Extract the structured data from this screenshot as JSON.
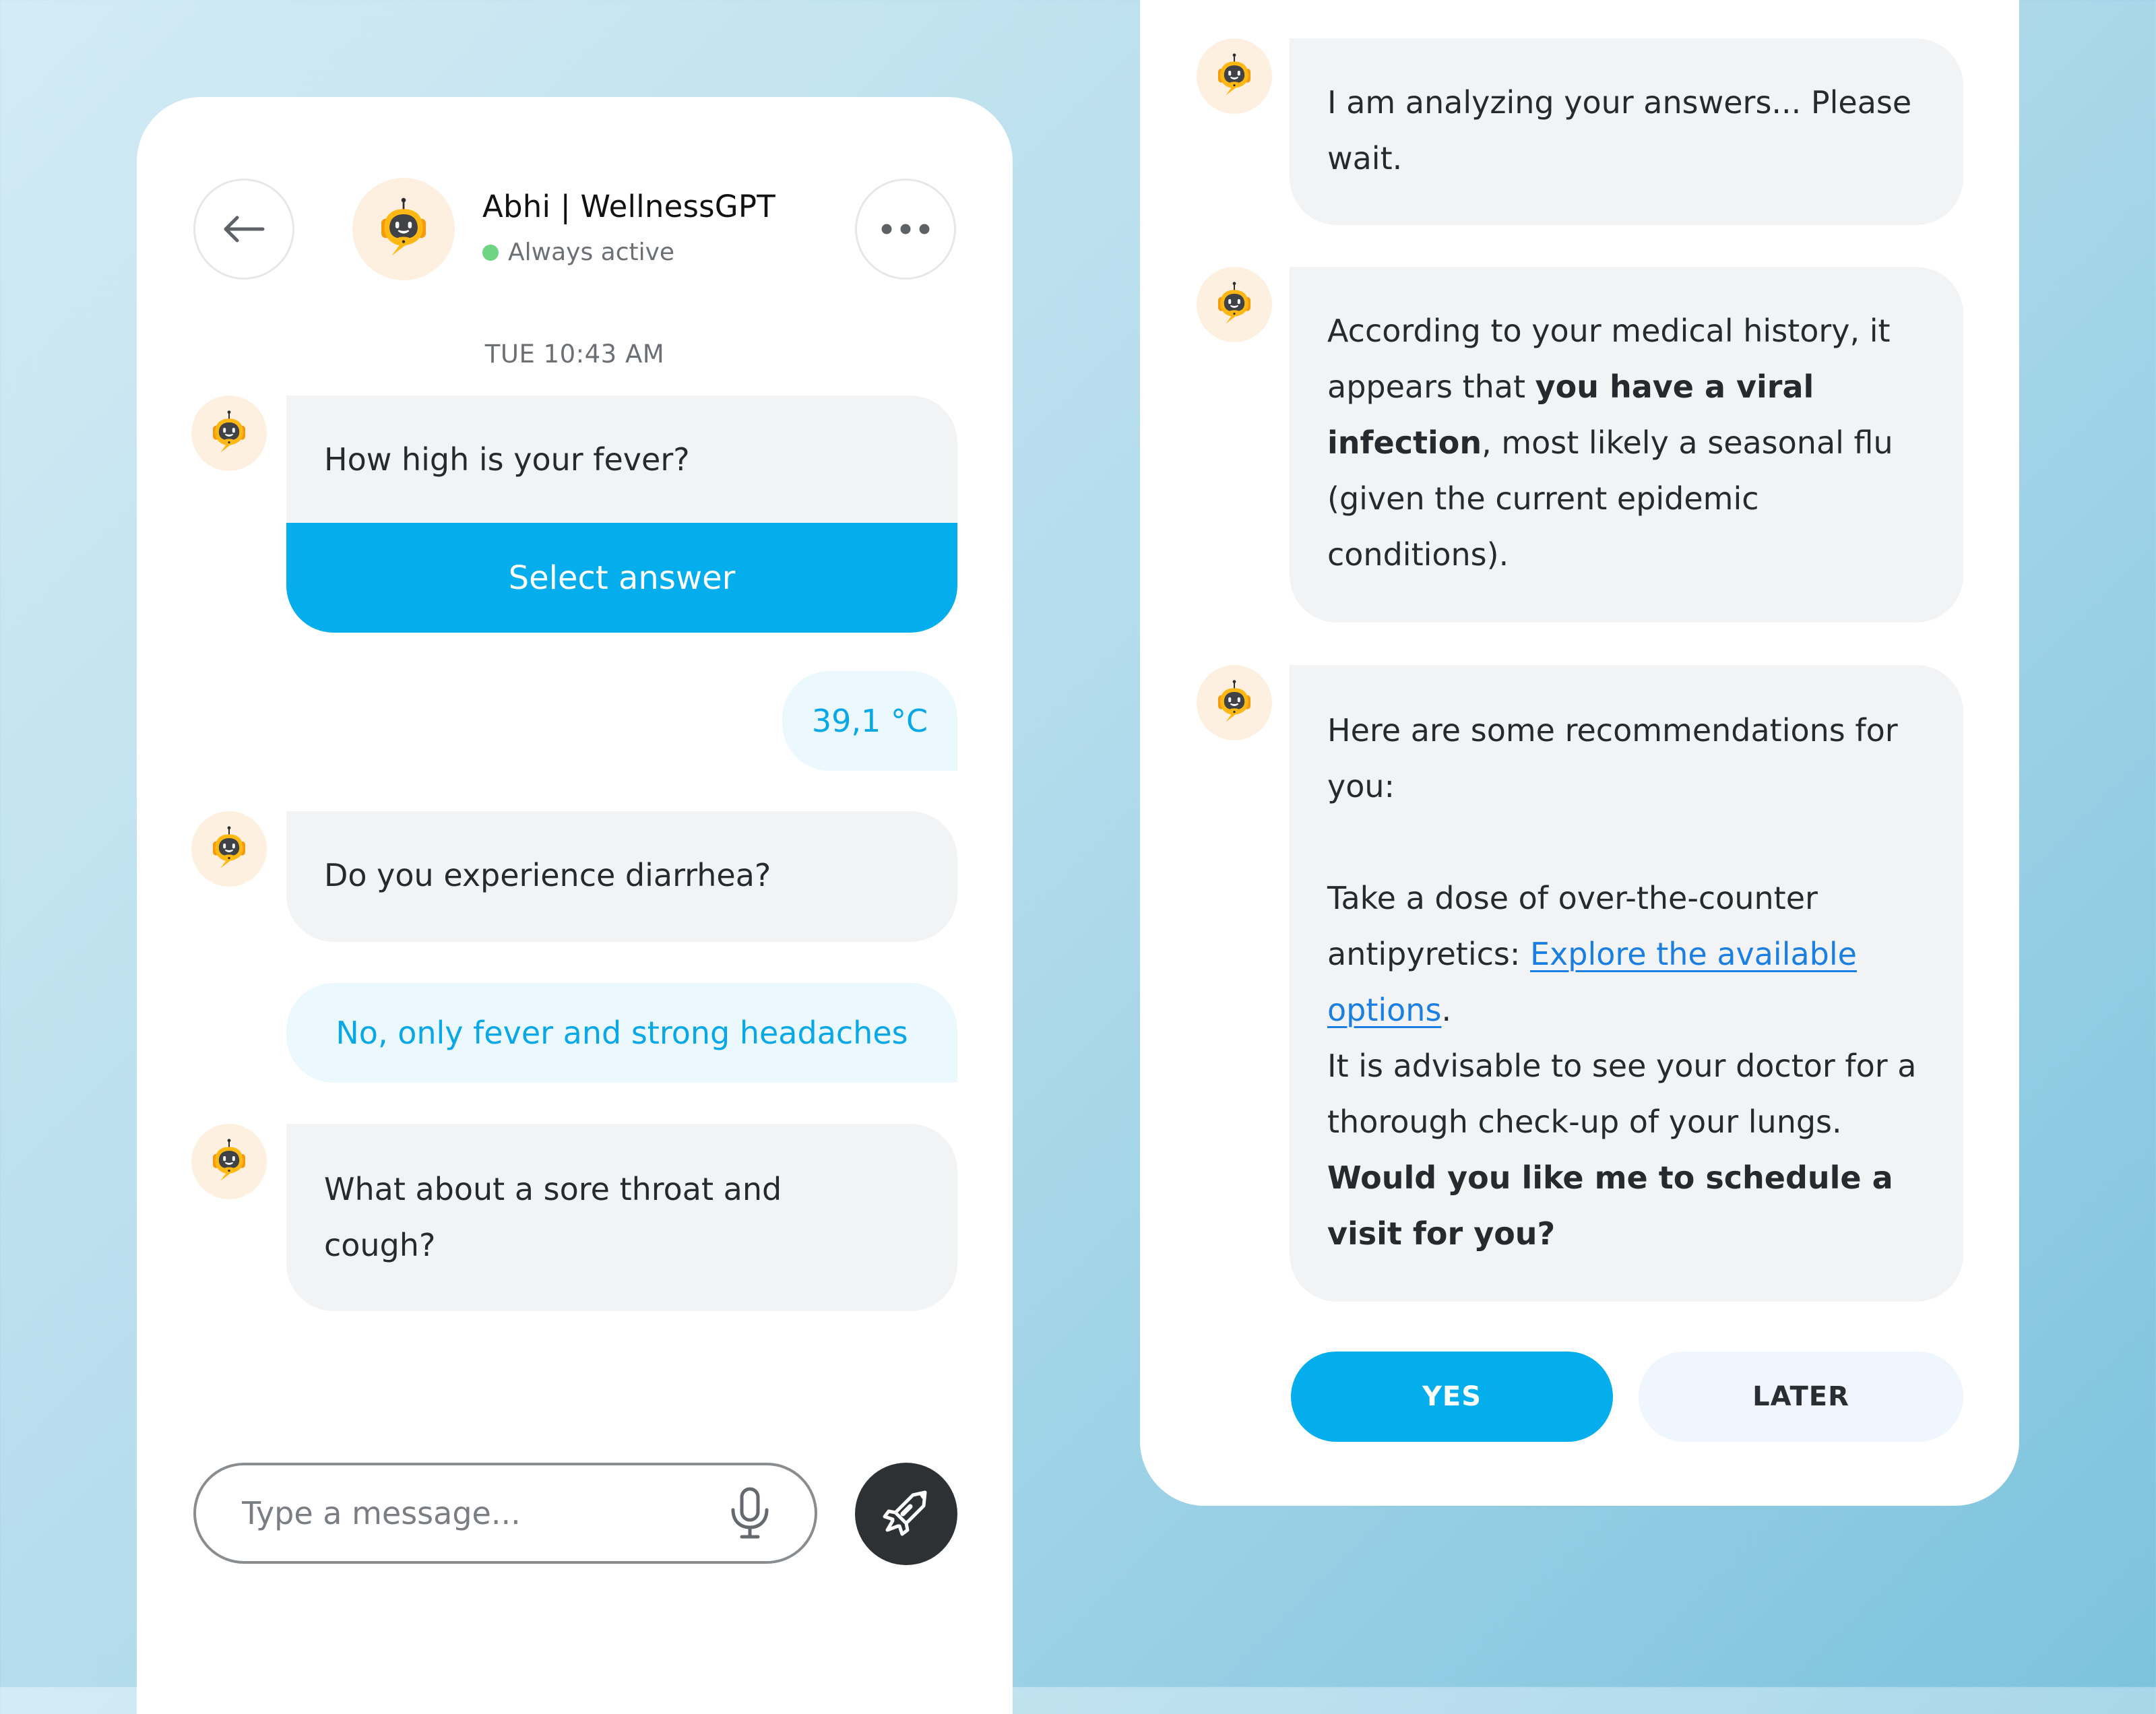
{
  "header": {
    "back_icon": "arrow-left-icon",
    "bot_name": "Abhi | WellnessGPT",
    "status": "Always active",
    "status_color": "#6FD584",
    "more_icon": "more-horizontal-icon"
  },
  "chat": {
    "timestamp": "TUE 10:43 AM",
    "messages": [
      {
        "from": "bot",
        "text": "How high is your fever?",
        "action_label": "Select answer"
      },
      {
        "from": "user",
        "text": "39,1 °C"
      },
      {
        "from": "bot",
        "text": "Do you experience diarrhea?"
      },
      {
        "from": "user",
        "text": "No, only fever and strong headaches"
      },
      {
        "from": "bot",
        "text": "What about a sore throat and cough?"
      }
    ]
  },
  "composer": {
    "placeholder": "Type a message...",
    "mic_icon": "microphone-icon",
    "send_icon": "rocket-icon"
  },
  "results": {
    "analyzing": "I am analyzing your answers... Please wait.",
    "diagnosis": {
      "prefix": "According to your medical history, it appears that ",
      "bold": "you have a viral infection",
      "suffix": ", most likely a seasonal flu (given the current epidemic conditions)."
    },
    "recommendations": {
      "intro": "Here are some recommendations for you:",
      "med_prefix": "Take a dose of over-the-counter antipyretics: ",
      "med_link": "Explore the available options",
      "med_suffix": ".",
      "doctor": "It is advisable to see your doctor for a thorough check-up of your lungs.",
      "question": "Would you like me to schedule a visit for you?"
    },
    "buttons": {
      "yes": "YES",
      "later": "LATER"
    }
  },
  "colors": {
    "accent": "#04AEEC",
    "user_bubble_bg": "#EBF8FD",
    "bot_bubble_bg": "#F2F3F5",
    "link": "#1A7FE0",
    "send_button": "#2E3133"
  }
}
